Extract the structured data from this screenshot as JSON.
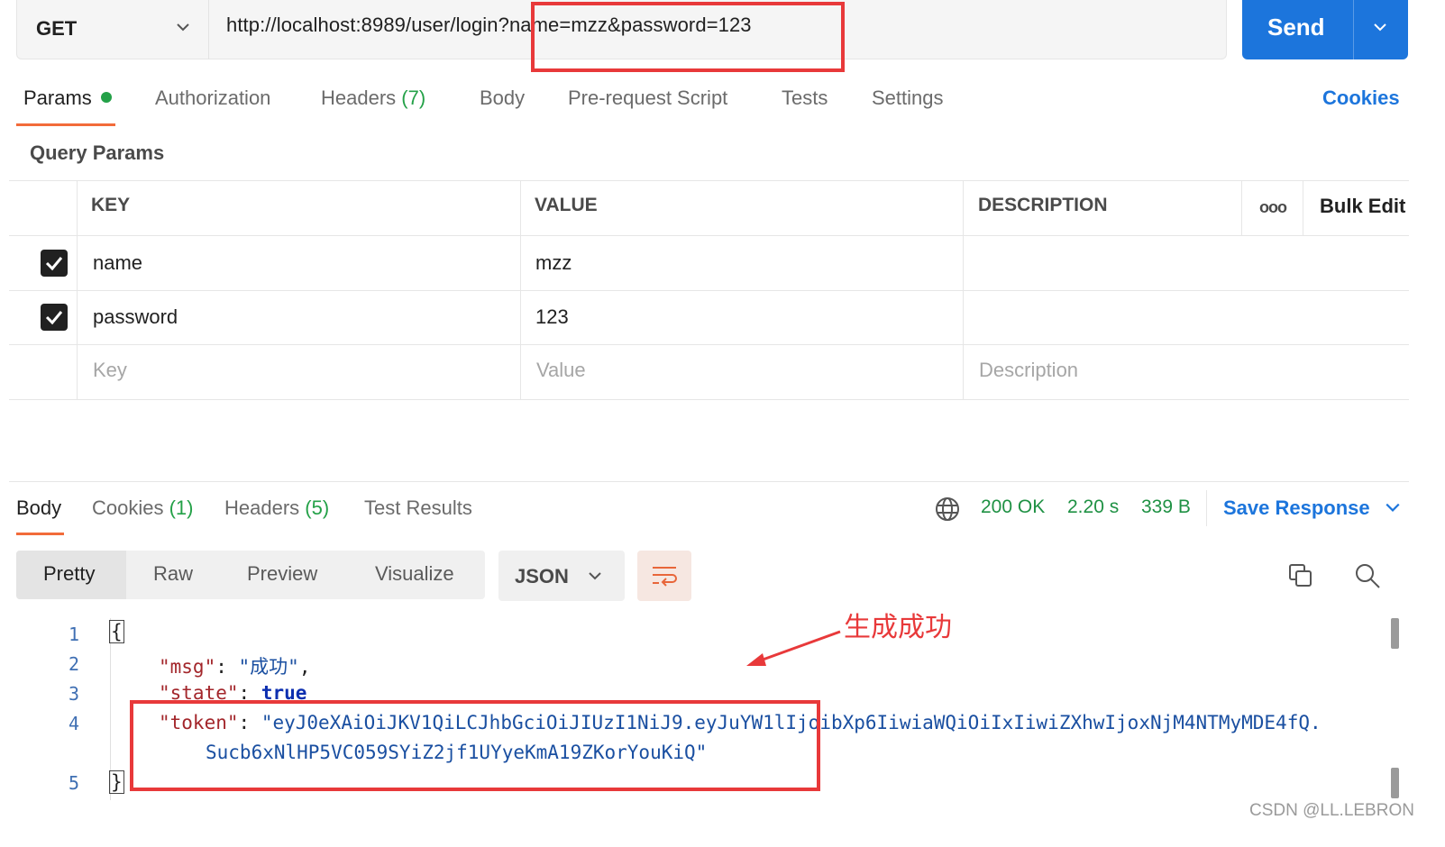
{
  "request": {
    "method": "GET",
    "url_base": "http://localhost:8989/user/login?",
    "url_query": "name=mzz&password=123",
    "send_label": "Send"
  },
  "tabs": {
    "params": "Params",
    "authorization": "Authorization",
    "headers": "Headers",
    "headers_count": "(7)",
    "body": "Body",
    "prerequest": "Pre-request Script",
    "tests": "Tests",
    "settings": "Settings",
    "cookies": "Cookies"
  },
  "query_params": {
    "title": "Query Params",
    "headers": {
      "key": "KEY",
      "value": "VALUE",
      "description": "DESCRIPTION",
      "more": "ooo",
      "bulk_edit": "Bulk Edit"
    },
    "rows": [
      {
        "checked": true,
        "key": "name",
        "value": "mzz"
      },
      {
        "checked": true,
        "key": "password",
        "value": "123"
      }
    ],
    "placeholder": {
      "key": "Key",
      "value": "Value",
      "description": "Description"
    }
  },
  "response": {
    "tabs": {
      "body": "Body",
      "cookies": "Cookies",
      "cookies_count": "(1)",
      "headers": "Headers",
      "headers_count": "(5)",
      "test_results": "Test Results"
    },
    "status": "200 OK",
    "time": "2.20 s",
    "size": "339 B",
    "save_label": "Save Response",
    "views": {
      "pretty": "Pretty",
      "raw": "Raw",
      "preview": "Preview",
      "visualize": "Visualize"
    },
    "format": "JSON",
    "lines": {
      "l1": "1",
      "l2": "2",
      "l3": "3",
      "l4": "4",
      "l5": "5"
    },
    "code": {
      "open": "{",
      "close": "}",
      "msg_key": "\"msg\"",
      "msg_val": "\"成功\"",
      "state_key": "\"state\"",
      "state_val": "true",
      "token_key": "\"token\"",
      "token_val_1": "\"eyJ0eXAiOiJKV1QiLCJhbGciOiJIUzI1NiJ9.eyJuYW1lIjoibXp6IiwiaWQiOiIxIiwiZXhwIjoxNjM4NTMyMDE4fQ.",
      "token_val_2": "Sucb6xNlHP5VC059SYiZ2jf1UYyeKmA19ZKorYouKiQ\""
    }
  },
  "annotation": {
    "text": "生成成功"
  },
  "watermark": "CSDN @LL.LEBRON",
  "colors": {
    "accent": "#1c75dc",
    "tab_underline": "#f26b3a",
    "status_green": "#1f9144",
    "annotation_red": "#e8393a"
  }
}
